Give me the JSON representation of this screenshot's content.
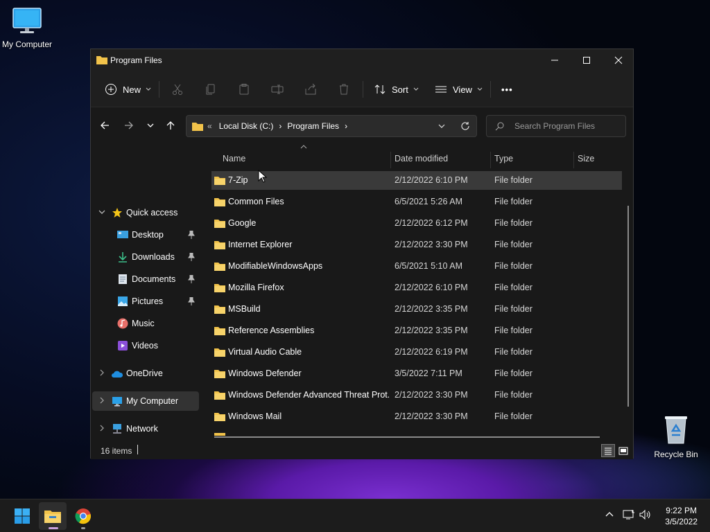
{
  "desktop": {
    "my_computer_label": "My Computer",
    "recycle_bin_label": "Recycle Bin"
  },
  "window": {
    "title": "Program Files",
    "controls": {
      "minimize": "minimize-icon",
      "maximize": "maximize-icon",
      "close": "close-icon"
    }
  },
  "toolbar": {
    "new_label": "New",
    "sort_label": "Sort",
    "view_label": "View",
    "more_label": "•••",
    "disabled_actions": [
      "cut-icon",
      "copy-icon",
      "paste-icon",
      "rename-icon",
      "share-icon",
      "delete-icon"
    ]
  },
  "address": {
    "overflow": "«",
    "crumb1": "Local Disk (C:)",
    "crumb2": "Program Files",
    "search_placeholder": "Search Program Files"
  },
  "nav": {
    "quick_access": "Quick access",
    "items": [
      {
        "label": "Desktop",
        "pinned": true,
        "icon": "desktop-icon"
      },
      {
        "label": "Downloads",
        "pinned": true,
        "icon": "download-icon"
      },
      {
        "label": "Documents",
        "pinned": true,
        "icon": "documents-icon"
      },
      {
        "label": "Pictures",
        "pinned": true,
        "icon": "pictures-icon"
      },
      {
        "label": "Music",
        "pinned": false,
        "icon": "music-icon"
      },
      {
        "label": "Videos",
        "pinned": false,
        "icon": "videos-icon"
      }
    ],
    "onedrive": "OneDrive",
    "my_computer": "My Computer",
    "network": "Network"
  },
  "columns": {
    "name": "Name",
    "date": "Date modified",
    "type": "Type",
    "size": "Size"
  },
  "files": [
    {
      "name": "7-Zip",
      "date": "2/12/2022 6:10 PM",
      "type": "File folder",
      "selected": true
    },
    {
      "name": "Common Files",
      "date": "6/5/2021 5:26 AM",
      "type": "File folder"
    },
    {
      "name": "Google",
      "date": "2/12/2022 6:12 PM",
      "type": "File folder"
    },
    {
      "name": "Internet Explorer",
      "date": "2/12/2022 3:30 PM",
      "type": "File folder"
    },
    {
      "name": "ModifiableWindowsApps",
      "date": "6/5/2021 5:10 AM",
      "type": "File folder"
    },
    {
      "name": "Mozilla Firefox",
      "date": "2/12/2022 6:10 PM",
      "type": "File folder"
    },
    {
      "name": "MSBuild",
      "date": "2/12/2022 3:35 PM",
      "type": "File folder"
    },
    {
      "name": "Reference Assemblies",
      "date": "2/12/2022 3:35 PM",
      "type": "File folder"
    },
    {
      "name": "Virtual Audio Cable",
      "date": "2/12/2022 6:19 PM",
      "type": "File folder"
    },
    {
      "name": "Windows Defender",
      "date": "3/5/2022 7:11 PM",
      "type": "File folder"
    },
    {
      "name": "Windows Defender Advanced Threat Prot...",
      "date": "2/12/2022 3:30 PM",
      "type": "File folder"
    },
    {
      "name": "Windows Mail",
      "date": "2/12/2022 3:30 PM",
      "type": "File folder"
    }
  ],
  "status": {
    "count": "16 items"
  },
  "taskbar": {
    "apps": [
      "start-icon",
      "file-explorer-icon",
      "chrome-icon"
    ],
    "time": "9:22 PM",
    "date": "3/5/2022"
  },
  "colors": {
    "folder": "#f2c34a",
    "window_bg": "#191919",
    "selection": "#3a3a3a",
    "accent": "#60cdff"
  }
}
